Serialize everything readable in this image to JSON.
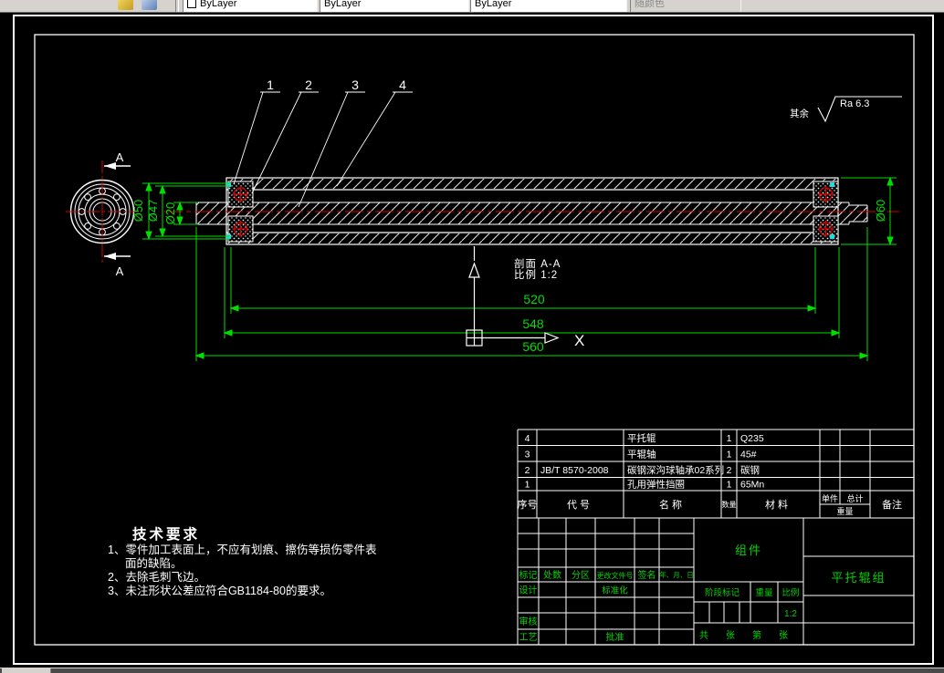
{
  "toolbar": {
    "color": "ByLayer",
    "linetype": "ByLayer",
    "lineweight": "ByLayer",
    "plotstyle": "随颜色"
  },
  "colors": {
    "dim_green": "#00dd00",
    "title_green": "#00d400",
    "centerline_red": "#d40000",
    "grip_cyan": "#18e0e0",
    "line_white": "#ffffff"
  },
  "drawing": {
    "balloons": {
      "b1": "1",
      "b2": "2",
      "b3": "3",
      "b4": "4"
    },
    "section_mark_top": "A",
    "section_mark_bottom": "A",
    "section_label": "剖面 A-A",
    "section_scale": "比例 1:2",
    "axis_x": "X",
    "rough_prefix": "其余",
    "rough_value": "Ra 6.3",
    "dims": {
      "d50": "Ø50",
      "d47": "Ø47",
      "d20": "Ø20",
      "d60": "Ø60",
      "len520": "520",
      "len548": "548",
      "len560": "560"
    }
  },
  "tech": {
    "title": "技术要求",
    "line1": "1、零件加工表面上，不应有划痕、擦伤等损伤零件表",
    "line2": "面的缺陷。",
    "line3": "2、去除毛刺飞边。",
    "line4": "3、未注形状公差应符合GB1184-80的要求。"
  },
  "parts": {
    "header": {
      "seq": "序号",
      "code": "代号",
      "name": "名称",
      "qty": "数量",
      "material": "材料",
      "unit": "单件",
      "total": "总计",
      "weight": "重量",
      "remark": "备注"
    },
    "rows": [
      {
        "seq": "4",
        "code": "",
        "name": "平托辊",
        "qty": "1",
        "material": "Q235"
      },
      {
        "seq": "3",
        "code": "",
        "name": "平辊轴",
        "qty": "1",
        "material": "45#"
      },
      {
        "seq": "2",
        "code": "JB/T 8570-2008",
        "name": "碳钢深沟球轴承02系列",
        "qty": "2",
        "material": "碳钢"
      },
      {
        "seq": "1",
        "code": "",
        "name": "孔用弹性挡圈",
        "qty": "1",
        "material": "65Mn"
      }
    ]
  },
  "titleblock": {
    "mark": "标记",
    "count": "处数",
    "zone": "分区",
    "change_doc": "更改文件号",
    "sign": "签名",
    "date": "年、月、日",
    "design": "设计",
    "standard": "标准化",
    "audit": "审核",
    "process": "工艺",
    "approve": "批准",
    "stage": "阶段标记",
    "weight": "重量",
    "scale": "比例",
    "scale_value": "1:2",
    "assembly": "组件",
    "title": "平托辊组",
    "sheet_total": "共",
    "sheet_zhang1": "张",
    "sheet_no": "第",
    "sheet_zhang2": "张"
  }
}
